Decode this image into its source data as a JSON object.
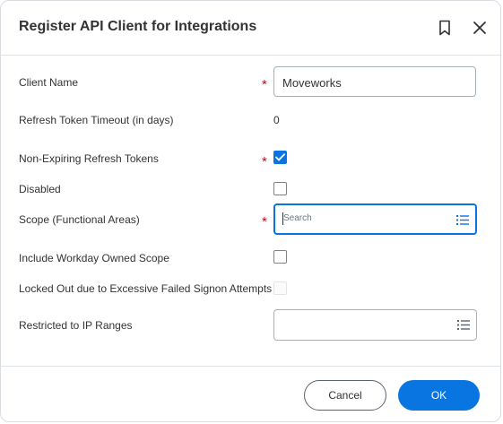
{
  "dialog": {
    "title": "Register API Client for Integrations",
    "bookmark_icon": "bookmark-icon",
    "close_icon": "close-icon"
  },
  "fields": {
    "client_name": {
      "label": "Client Name",
      "required": "*",
      "value": "Moveworks"
    },
    "refresh_timeout": {
      "label": "Refresh Token Timeout (in days)",
      "value": "0"
    },
    "non_expiring": {
      "label": "Non-Expiring Refresh Tokens",
      "required": "*",
      "checked": true
    },
    "disabled": {
      "label": "Disabled",
      "checked": false
    },
    "scope": {
      "label": "Scope (Functional Areas)",
      "required": "*",
      "placeholder": "Search",
      "icon": "list-icon"
    },
    "workday_scope": {
      "label": "Include Workday Owned Scope",
      "checked": false
    },
    "locked_out": {
      "label": "Locked Out due to Excessive Failed Signon Attempts",
      "checked": false,
      "disabled": true
    },
    "ip_ranges": {
      "label": "Restricted to IP Ranges",
      "value": "",
      "icon": "list-icon"
    }
  },
  "footer": {
    "cancel_label": "Cancel",
    "ok_label": "OK"
  },
  "colors": {
    "accent": "#0875e1",
    "required": "#d0021b",
    "border": "#a6b0ba"
  }
}
